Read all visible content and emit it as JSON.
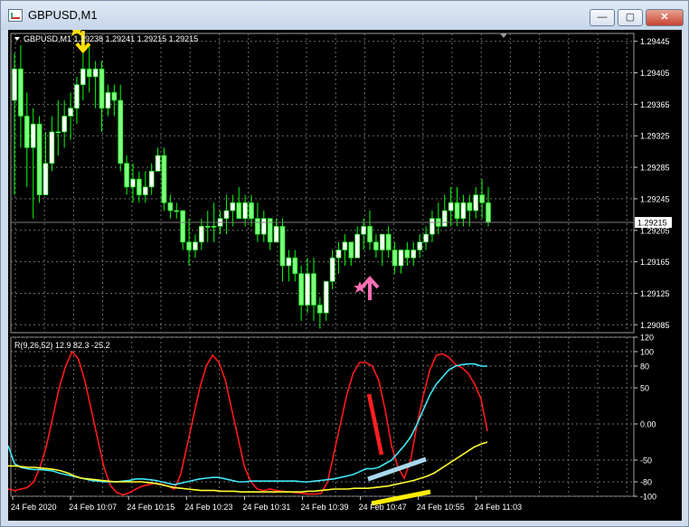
{
  "window": {
    "title": "GBPUSD,M1",
    "minimize_glyph": "—",
    "maximize_glyph": "▢",
    "close_glyph": "✕"
  },
  "price_panel": {
    "header": "GBPUSD,M1  1.29238 1.29241 1.29215 1.29215",
    "current_price_label": "1.29215"
  },
  "indicator_panel": {
    "header": "R(9,26,52) 12.9 82.3 -25.2"
  },
  "colors": {
    "background": "#000000",
    "grid": "#6e6e6e",
    "candle_bull": "#ffffff",
    "candle_bear": "#7fff7f",
    "wick": "#00ff00",
    "red_line": "#ff1a1a",
    "cyan_line": "#40e8f8",
    "yellow_line": "#ffff33",
    "arrow_down": "#ffe000",
    "arrow_up": "#ff6fb4",
    "annotation_red": "#ff2020",
    "annotation_blue": "#a9d8ee",
    "annotation_yellow": "#ffee00"
  },
  "chart_data": [
    {
      "type": "candlestick",
      "title": "GBPUSD,M1",
      "ylim": [
        1.29075,
        1.29455
      ],
      "y_ticks": [
        "1.29445",
        "1.29405",
        "1.29365",
        "1.29325",
        "1.29285",
        "1.29245",
        "1.29205",
        "1.29165",
        "1.29125",
        "1.29085"
      ],
      "current_price": 1.29215,
      "markers": [
        {
          "type": "arrow-down",
          "color": "yellow",
          "time": "24 Feb 10:07",
          "price": 1.2941
        },
        {
          "type": "arrow-up",
          "color": "pink",
          "time": "24 Feb 10:47",
          "price": 1.2913
        }
      ],
      "candles": [
        {
          "o": 1.2937,
          "h": 1.2943,
          "l": 1.2925,
          "c": 1.2941
        },
        {
          "o": 1.2941,
          "h": 1.2944,
          "l": 1.2931,
          "c": 1.2935
        },
        {
          "o": 1.2935,
          "h": 1.2938,
          "l": 1.2926,
          "c": 1.2931
        },
        {
          "o": 1.2931,
          "h": 1.2936,
          "l": 1.2922,
          "c": 1.2934
        },
        {
          "o": 1.2934,
          "h": 1.2935,
          "l": 1.2924,
          "c": 1.2925
        },
        {
          "o": 1.2925,
          "h": 1.2933,
          "l": 1.2925,
          "c": 1.2929
        },
        {
          "o": 1.2929,
          "h": 1.2935,
          "l": 1.2928,
          "c": 1.2933
        },
        {
          "o": 1.2933,
          "h": 1.2937,
          "l": 1.293,
          "c": 1.2933
        },
        {
          "o": 1.2933,
          "h": 1.2937,
          "l": 1.2931,
          "c": 1.2935
        },
        {
          "o": 1.2935,
          "h": 1.2938,
          "l": 1.2932,
          "c": 1.2936
        },
        {
          "o": 1.2936,
          "h": 1.294,
          "l": 1.2934,
          "c": 1.2939
        },
        {
          "o": 1.2939,
          "h": 1.2943,
          "l": 1.2937,
          "c": 1.2941
        },
        {
          "o": 1.2941,
          "h": 1.2944,
          "l": 1.2938,
          "c": 1.294
        },
        {
          "o": 1.294,
          "h": 1.2942,
          "l": 1.2936,
          "c": 1.2941
        },
        {
          "o": 1.2941,
          "h": 1.2942,
          "l": 1.2933,
          "c": 1.2936
        },
        {
          "o": 1.2936,
          "h": 1.2939,
          "l": 1.2935,
          "c": 1.2938
        },
        {
          "o": 1.2938,
          "h": 1.2939,
          "l": 1.2935,
          "c": 1.2937
        },
        {
          "o": 1.2937,
          "h": 1.2939,
          "l": 1.2928,
          "c": 1.2929
        },
        {
          "o": 1.2929,
          "h": 1.293,
          "l": 1.2925,
          "c": 1.2926
        },
        {
          "o": 1.2926,
          "h": 1.2929,
          "l": 1.2924,
          "c": 1.2927
        },
        {
          "o": 1.2927,
          "h": 1.2928,
          "l": 1.2924,
          "c": 1.2925
        },
        {
          "o": 1.2925,
          "h": 1.2928,
          "l": 1.2924,
          "c": 1.2926
        },
        {
          "o": 1.2926,
          "h": 1.2929,
          "l": 1.2925,
          "c": 1.2928
        },
        {
          "o": 1.2928,
          "h": 1.2931,
          "l": 1.2928,
          "c": 1.293
        },
        {
          "o": 1.293,
          "h": 1.2931,
          "l": 1.2923,
          "c": 1.2924
        },
        {
          "o": 1.2924,
          "h": 1.2925,
          "l": 1.2922,
          "c": 1.2923
        },
        {
          "o": 1.2923,
          "h": 1.2924,
          "l": 1.2922,
          "c": 1.2923
        },
        {
          "o": 1.2923,
          "h": 1.2923,
          "l": 1.2918,
          "c": 1.2919
        },
        {
          "o": 1.2919,
          "h": 1.2922,
          "l": 1.2916,
          "c": 1.2918
        },
        {
          "o": 1.2918,
          "h": 1.292,
          "l": 1.2917,
          "c": 1.2919
        },
        {
          "o": 1.2919,
          "h": 1.2922,
          "l": 1.2918,
          "c": 1.2921
        },
        {
          "o": 1.2921,
          "h": 1.2923,
          "l": 1.2919,
          "c": 1.2921
        },
        {
          "o": 1.2921,
          "h": 1.2924,
          "l": 1.2919,
          "c": 1.2921
        },
        {
          "o": 1.2921,
          "h": 1.2923,
          "l": 1.292,
          "c": 1.2922
        },
        {
          "o": 1.2922,
          "h": 1.2925,
          "l": 1.292,
          "c": 1.2923
        },
        {
          "o": 1.2923,
          "h": 1.2925,
          "l": 1.2921,
          "c": 1.2924
        },
        {
          "o": 1.2924,
          "h": 1.2926,
          "l": 1.2922,
          "c": 1.2922
        },
        {
          "o": 1.2922,
          "h": 1.2925,
          "l": 1.2921,
          "c": 1.2924
        },
        {
          "o": 1.2924,
          "h": 1.2925,
          "l": 1.2921,
          "c": 1.2922
        },
        {
          "o": 1.2922,
          "h": 1.2924,
          "l": 1.2919,
          "c": 1.292
        },
        {
          "o": 1.292,
          "h": 1.2923,
          "l": 1.2919,
          "c": 1.2922
        },
        {
          "o": 1.2922,
          "h": 1.2922,
          "l": 1.2918,
          "c": 1.2919
        },
        {
          "o": 1.2919,
          "h": 1.2922,
          "l": 1.2919,
          "c": 1.2921
        },
        {
          "o": 1.2921,
          "h": 1.2922,
          "l": 1.2914,
          "c": 1.2916
        },
        {
          "o": 1.2916,
          "h": 1.2918,
          "l": 1.2914,
          "c": 1.2917
        },
        {
          "o": 1.2917,
          "h": 1.2918,
          "l": 1.2914,
          "c": 1.2915
        },
        {
          "o": 1.2915,
          "h": 1.2916,
          "l": 1.2909,
          "c": 1.2911
        },
        {
          "o": 1.2911,
          "h": 1.2917,
          "l": 1.291,
          "c": 1.2915
        },
        {
          "o": 1.2915,
          "h": 1.2917,
          "l": 1.2909,
          "c": 1.2911
        },
        {
          "o": 1.2911,
          "h": 1.2912,
          "l": 1.2908,
          "c": 1.291
        },
        {
          "o": 1.291,
          "h": 1.2914,
          "l": 1.2909,
          "c": 1.2914
        },
        {
          "o": 1.2914,
          "h": 1.2918,
          "l": 1.2913,
          "c": 1.2917
        },
        {
          "o": 1.2917,
          "h": 1.2919,
          "l": 1.2915,
          "c": 1.2918
        },
        {
          "o": 1.2918,
          "h": 1.292,
          "l": 1.2916,
          "c": 1.2919
        },
        {
          "o": 1.2919,
          "h": 1.2919,
          "l": 1.2916,
          "c": 1.2917
        },
        {
          "o": 1.2917,
          "h": 1.2921,
          "l": 1.2917,
          "c": 1.292
        },
        {
          "o": 1.292,
          "h": 1.2922,
          "l": 1.2918,
          "c": 1.2921
        },
        {
          "o": 1.2921,
          "h": 1.2923,
          "l": 1.2918,
          "c": 1.2919
        },
        {
          "o": 1.2919,
          "h": 1.292,
          "l": 1.2917,
          "c": 1.2918
        },
        {
          "o": 1.2918,
          "h": 1.292,
          "l": 1.2916,
          "c": 1.292
        },
        {
          "o": 1.292,
          "h": 1.2921,
          "l": 1.2917,
          "c": 1.2918
        },
        {
          "o": 1.2918,
          "h": 1.2919,
          "l": 1.2915,
          "c": 1.2916
        },
        {
          "o": 1.2916,
          "h": 1.2918,
          "l": 1.2915,
          "c": 1.2918
        },
        {
          "o": 1.2918,
          "h": 1.2919,
          "l": 1.2916,
          "c": 1.2917
        },
        {
          "o": 1.2917,
          "h": 1.2919,
          "l": 1.2916,
          "c": 1.2918
        },
        {
          "o": 1.2918,
          "h": 1.292,
          "l": 1.2917,
          "c": 1.2919
        },
        {
          "o": 1.2919,
          "h": 1.2921,
          "l": 1.2918,
          "c": 1.292
        },
        {
          "o": 1.292,
          "h": 1.2923,
          "l": 1.2919,
          "c": 1.2922
        },
        {
          "o": 1.2922,
          "h": 1.2924,
          "l": 1.292,
          "c": 1.2921
        },
        {
          "o": 1.2921,
          "h": 1.2925,
          "l": 1.2921,
          "c": 1.2923
        },
        {
          "o": 1.2923,
          "h": 1.2926,
          "l": 1.2921,
          "c": 1.2924
        },
        {
          "o": 1.2924,
          "h": 1.2926,
          "l": 1.2921,
          "c": 1.2922
        },
        {
          "o": 1.2922,
          "h": 1.2925,
          "l": 1.2921,
          "c": 1.2924
        },
        {
          "o": 1.2924,
          "h": 1.2925,
          "l": 1.2921,
          "c": 1.2923
        },
        {
          "o": 1.2923,
          "h": 1.2926,
          "l": 1.2922,
          "c": 1.2925
        },
        {
          "o": 1.2925,
          "h": 1.2927,
          "l": 1.2922,
          "c": 1.2924
        },
        {
          "o": 1.2924,
          "h": 1.2926,
          "l": 1.2921,
          "c": 1.29215
        }
      ]
    },
    {
      "type": "line",
      "title": "R(9,26,52) 12.9 82.3 -25.2",
      "ylim": [
        -100,
        120
      ],
      "y_ticks": [
        120,
        100,
        80,
        50,
        0,
        -50,
        -80,
        -100
      ],
      "x_tick_labels": [
        "24 Feb 2020",
        "24 Feb 10:07",
        "24 Feb 10:15",
        "24 Feb 10:23",
        "24 Feb 10:31",
        "24 Feb 10:39",
        "24 Feb 10:47",
        "24 Feb 10:55",
        "24 Feb 11:03"
      ],
      "series": [
        {
          "color": "red",
          "values": [
            -90,
            -92,
            -90,
            -88,
            -80,
            -60,
            -30,
            10,
            50,
            80,
            100,
            90,
            60,
            20,
            -20,
            -60,
            -85,
            -95,
            -98,
            -95,
            -90,
            -86,
            -84,
            -82,
            -83,
            -86,
            -90,
            -70,
            -30,
            10,
            50,
            80,
            95,
            85,
            60,
            20,
            -20,
            -60,
            -80,
            -90,
            -92,
            -90,
            -92,
            -93,
            -94,
            -95,
            -96,
            -97,
            -97,
            -96,
            -80,
            -40,
            0,
            40,
            70,
            85,
            85,
            80,
            60,
            20,
            -30,
            -60,
            -75,
            -50,
            0,
            40,
            75,
            95,
            97,
            92,
            82,
            78,
            70,
            55,
            35,
            -10
          ]
        },
        {
          "color": "cyan",
          "values": [
            -30,
            -55,
            -60,
            -62,
            -63,
            -63,
            -64,
            -65,
            -68,
            -70,
            -72,
            -74,
            -76,
            -78,
            -79,
            -80,
            -80,
            -80,
            -79,
            -78,
            -76,
            -76,
            -77,
            -78,
            -80,
            -82,
            -84,
            -82,
            -80,
            -78,
            -76,
            -75,
            -74,
            -74,
            -76,
            -78,
            -80,
            -80,
            -79,
            -79,
            -79,
            -79,
            -79,
            -79,
            -79,
            -79,
            -80,
            -80,
            -79,
            -78,
            -77,
            -76,
            -74,
            -72,
            -70,
            -66,
            -62,
            -62,
            -60,
            -55,
            -50,
            -40,
            -30,
            -18,
            0,
            20,
            40,
            55,
            65,
            75,
            80,
            82,
            83,
            83,
            80,
            80
          ]
        },
        {
          "color": "yellow",
          "values": [
            -58,
            -58,
            -59,
            -60,
            -60,
            -61,
            -62,
            -63,
            -65,
            -68,
            -72,
            -75,
            -76,
            -77,
            -78,
            -79,
            -80,
            -80,
            -80,
            -80,
            -80,
            -81,
            -82,
            -84,
            -86,
            -88,
            -89,
            -90,
            -91,
            -92,
            -92,
            -92,
            -93,
            -93,
            -93,
            -94,
            -94,
            -94,
            -94,
            -94,
            -94,
            -94,
            -94,
            -94,
            -94,
            -93,
            -93,
            -92,
            -91,
            -90,
            -90,
            -90,
            -89,
            -89,
            -89,
            -88,
            -87,
            -86,
            -84,
            -82,
            -80,
            -78,
            -75,
            -72,
            -68,
            -62,
            -56,
            -50,
            -44,
            -38,
            -32,
            -28,
            -25
          ]
        }
      ]
    }
  ]
}
